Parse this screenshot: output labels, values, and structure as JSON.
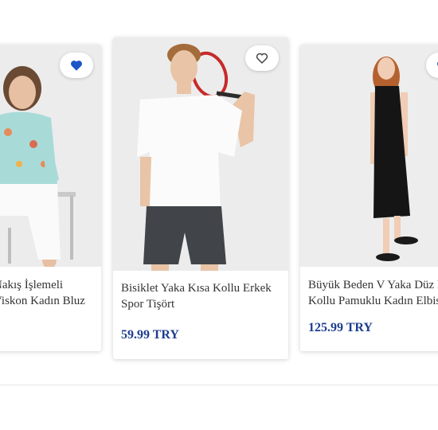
{
  "products": [
    {
      "title_line1": "Nakış İşlemeli",
      "title_line2": "Viskon Kadın Bluz",
      "price": "",
      "favorite": "heart-filled-icon",
      "favorite_color": "#1e55c8"
    },
    {
      "title_line1": "Bisiklet Yaka Kısa Kollu Erkek",
      "title_line2": "Spor Tişört",
      "price": "59.99 TRY",
      "favorite": "heart-outline-icon"
    },
    {
      "title_line1": "Büyük Beden V Yaka Düz Kı",
      "title_line2": "Kollu Pamuklu Kadın Elbise",
      "price": "125.99 TRY",
      "favorite": "heart-icon"
    }
  ],
  "colors": {
    "price": "#1d3d8f",
    "title": "#333333"
  }
}
